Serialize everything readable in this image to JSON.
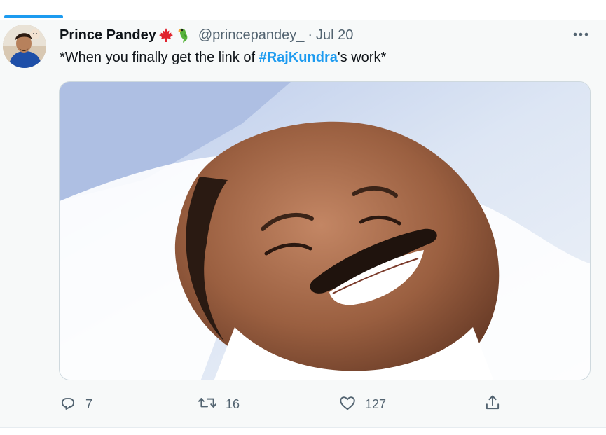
{
  "tweet": {
    "author_name": "Prince Pandey",
    "author_emojis": [
      "maple-leaf-emoji",
      "parrot-emoji"
    ],
    "handle": "@princepandey_",
    "separator": "·",
    "date": "Jul 20",
    "text_before": "*When you finally get the link of ",
    "hashtag": "#RajKundra",
    "text_after": "'s work*",
    "media_description_icon": "meme-image",
    "more_icon": "more-dots-icon"
  },
  "actions": {
    "reply": {
      "icon": "reply-icon",
      "count": "7"
    },
    "retweet": {
      "icon": "retweet-icon",
      "count": "16"
    },
    "like": {
      "icon": "heart-icon",
      "count": "127"
    },
    "share": {
      "icon": "share-icon",
      "count": ""
    }
  },
  "colors": {
    "accent": "#1d9bf0",
    "text_primary": "#0f1419",
    "text_secondary": "#536471",
    "background": "#f7f9f9"
  }
}
